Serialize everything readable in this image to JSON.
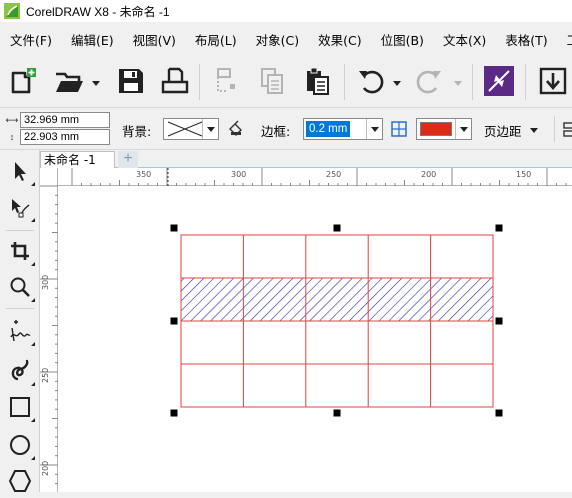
{
  "window": {
    "title": "CorelDRAW X8 - 未命名 -1"
  },
  "menu": [
    {
      "label": "文件(F)",
      "name": "menu-file"
    },
    {
      "label": "编辑(E)",
      "name": "menu-edit"
    },
    {
      "label": "视图(V)",
      "name": "menu-view"
    },
    {
      "label": "布局(L)",
      "name": "menu-layout"
    },
    {
      "label": "对象(C)",
      "name": "menu-object"
    },
    {
      "label": "效果(C)",
      "name": "menu-effects"
    },
    {
      "label": "位图(B)",
      "name": "menu-bitmaps"
    },
    {
      "label": "文本(X)",
      "name": "menu-text"
    },
    {
      "label": "表格(T)",
      "name": "menu-table"
    },
    {
      "label": "工具",
      "name": "menu-tools"
    }
  ],
  "property_bar": {
    "width_value": "32.969 mm",
    "height_value": "22.903 mm",
    "background_label": "背景:",
    "outline_label": "边框:",
    "outline_width": "0.2 mm",
    "page_margin_label": "页边距",
    "outline_color": "#e02a14"
  },
  "document": {
    "tab_label": "未命名 -1"
  },
  "ruler": {
    "h_labels": [
      "350",
      "300",
      "250",
      "200",
      "150"
    ],
    "v_labels": [
      "300",
      "250",
      "200"
    ]
  },
  "table_object": {
    "rows": 4,
    "cols": 5,
    "line_color": "#e0443c",
    "hatched_row": 2,
    "hatch_color": "#2a2ab0"
  },
  "colors": {
    "accent": "#0078d7",
    "icon_dark": "#222222",
    "disabled_icon": "#b4b4b4",
    "effect_tool": "#5a2a86"
  }
}
